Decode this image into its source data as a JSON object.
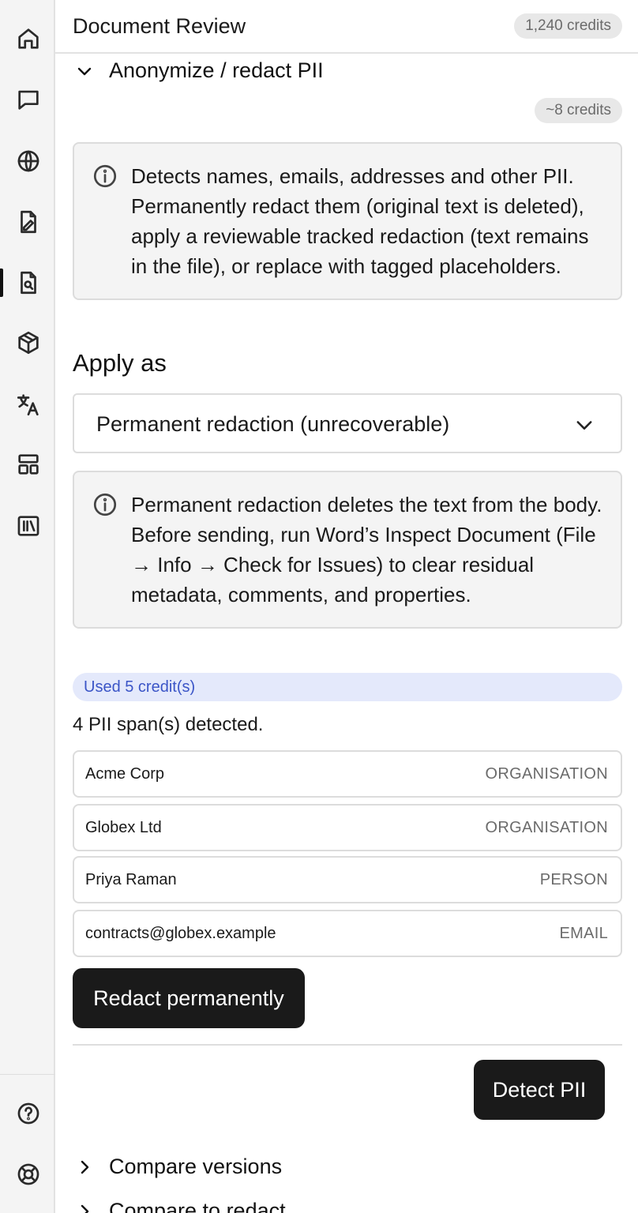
{
  "header": {
    "title": "Document Review",
    "credits_balance": "1,240 credits"
  },
  "sidebar": {
    "items": [
      {
        "icon": "home-icon"
      },
      {
        "icon": "chat-icon"
      },
      {
        "icon": "globe-icon"
      },
      {
        "icon": "document-edit-icon"
      },
      {
        "icon": "document-search-icon",
        "active": true
      },
      {
        "icon": "cube-icon"
      },
      {
        "icon": "translate-icon"
      },
      {
        "icon": "layout-icon"
      },
      {
        "icon": "library-icon"
      }
    ],
    "bottom": [
      {
        "icon": "help-icon"
      },
      {
        "icon": "support-icon"
      }
    ]
  },
  "anonymize": {
    "title": "Anonymize / redact PII",
    "cost": "~8 credits",
    "description": "Detects names, emails, addresses and other PII. Permanently redact them (original text is deleted), apply a reviewable tracked redaction (text remains in the file), or replace with tagged placeholders.",
    "apply_as_label": "Apply as",
    "apply_as_value": "Permanent redaction (unrecoverable)",
    "warning": "Permanent redaction deletes the text from the body. Before sending, run Word’s Inspect Document (File → Info → Check for Issues) to clear residual metadata, comments, and properties.",
    "credits_used": "Used 5 credit(s)",
    "spans_detected": "4 PII span(s) detected.",
    "spans": [
      {
        "text": "Acme Corp",
        "type": "ORGANISATION"
      },
      {
        "text": "Globex Ltd",
        "type": "ORGANISATION"
      },
      {
        "text": "Priya Raman",
        "type": "PERSON"
      },
      {
        "text": "contracts@globex.example",
        "type": "EMAIL"
      }
    ],
    "redact_button": "Redact permanently",
    "detect_button": "Detect PII"
  },
  "sections": [
    {
      "title": "Compare versions"
    },
    {
      "title": "Compare to redact"
    }
  ],
  "colors": {
    "accent_dark": "#1a1a1a",
    "credits_badge_bg": "#e4e9fb",
    "credits_badge_text": "#3b55c7"
  }
}
